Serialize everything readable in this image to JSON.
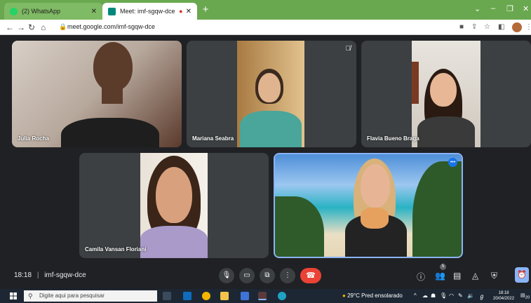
{
  "browser": {
    "tabs": [
      {
        "title": "(2) WhatsApp",
        "favicon": "whatsapp-icon",
        "color": "#25d366"
      },
      {
        "title": "Meet: imf-sgqw-dce",
        "favicon": "meet-icon",
        "color": "#00897b"
      }
    ],
    "url": "meet.google.com/imf-sgqw-dce"
  },
  "participants": [
    {
      "name": "Julia Rocha"
    },
    {
      "name": "Mariana Seabra"
    },
    {
      "name": "Flavia Bueno Braga"
    },
    {
      "name": "Camila Vansan Floriani"
    },
    {
      "name": ""
    }
  ],
  "meeting": {
    "time": "18:18",
    "separator": "|",
    "code": "imf-sgqw-dce",
    "people_count": "5"
  },
  "taskbar": {
    "search_placeholder": "Digite aqui para pesquisar",
    "weather": "29°C  Pred ensolarado",
    "time": "18:18",
    "date": "20/04/2022",
    "notifications": "20"
  },
  "colors": {
    "accent": "#8ab4f8",
    "end_call": "#ea4335",
    "tab_bar": "#6aa84f"
  }
}
